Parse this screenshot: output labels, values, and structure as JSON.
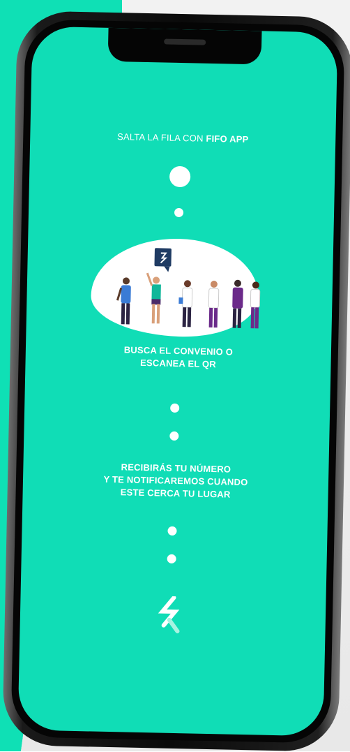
{
  "hero": {
    "tagline_prefix": "SALTA LA FILA CON ",
    "tagline_brand": "FIFO APP"
  },
  "steps": [
    {
      "line1": "BUSCA EL CONVENIO O",
      "line2": "ESCANEA EL QR"
    },
    {
      "line1": "RECIBIRÁS TU NÚMERO",
      "line2": "Y TE NOTIFICAREMOS CUANDO",
      "line3": "ESTE CERCA TU LUGAR"
    }
  ],
  "icons": {
    "chat_bubble": "fifo-logo-speech-bubble-icon",
    "brand_logo": "fifo-logo-icon"
  },
  "colors": {
    "screen": "#10ddb6",
    "accent": "#0fe0b5",
    "bubble": "#1f3b63"
  }
}
